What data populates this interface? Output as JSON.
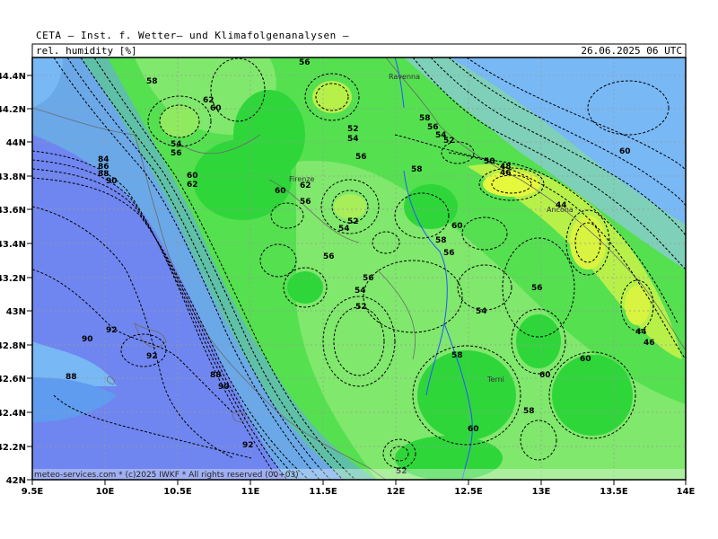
{
  "header": {
    "institute": "CETA — Inst. f. Wetter— und Klimafolgenanalysen —",
    "parameter": "rel. humidity [%]",
    "datetime": "26.06.2025  06 UTC"
  },
  "footer": {
    "copyright": "meteo-services.com * (c)2025 IWKF * All rights reserved (00+03)"
  },
  "axes": {
    "lon_ticks": [
      "9.5E",
      "10E",
      "10.5E",
      "11E",
      "11.5E",
      "12E",
      "12.5E",
      "13E",
      "13.5E",
      "14E"
    ],
    "lat_ticks": [
      "44.4N",
      "44.2N",
      "44N",
      "43.8N",
      "43.6N",
      "43.4N",
      "43.2N",
      "43N",
      "42.8N",
      "42.6N",
      "42.4N",
      "42.2N",
      "42N"
    ]
  },
  "cities": [
    "Ravenna",
    "Firenze",
    "Ancona",
    "Terni"
  ],
  "colors": {
    "sea_blue": "#6f86f0",
    "sky_blue": "#78b8f5",
    "green": "#2fd63a",
    "light_green": "#7ee86a",
    "yellow_green": "#c4f046",
    "rivers": "#2255ff"
  },
  "contour_labels": [
    {
      "text": "56"
    },
    {
      "text": "58"
    },
    {
      "text": "62"
    },
    {
      "text": "60"
    },
    {
      "text": "54"
    },
    {
      "text": "56"
    },
    {
      "text": "60"
    },
    {
      "text": "62"
    },
    {
      "text": "84"
    },
    {
      "text": "86"
    },
    {
      "text": "88"
    },
    {
      "text": "90"
    },
    {
      "text": "60"
    },
    {
      "text": "62"
    },
    {
      "text": "56"
    },
    {
      "text": "52"
    },
    {
      "text": "54"
    },
    {
      "text": "52"
    },
    {
      "text": "54"
    },
    {
      "text": "56"
    },
    {
      "text": "58"
    },
    {
      "text": "56"
    },
    {
      "text": "54"
    },
    {
      "text": "52"
    },
    {
      "text": "50"
    },
    {
      "text": "48"
    },
    {
      "text": "46"
    },
    {
      "text": "60"
    },
    {
      "text": "58"
    },
    {
      "text": "60"
    },
    {
      "text": "58"
    },
    {
      "text": "56"
    },
    {
      "text": "44"
    },
    {
      "text": "56"
    },
    {
      "text": "56"
    },
    {
      "text": "54"
    },
    {
      "text": "52"
    },
    {
      "text": "54"
    },
    {
      "text": "56"
    },
    {
      "text": "92"
    },
    {
      "text": "90"
    },
    {
      "text": "92"
    },
    {
      "text": "88"
    },
    {
      "text": "90"
    },
    {
      "text": "88"
    },
    {
      "text": "58"
    },
    {
      "text": "60"
    },
    {
      "text": "60"
    },
    {
      "text": "44"
    },
    {
      "text": "46"
    },
    {
      "text": "58"
    },
    {
      "text": "60"
    },
    {
      "text": "92"
    },
    {
      "text": "52"
    }
  ]
}
